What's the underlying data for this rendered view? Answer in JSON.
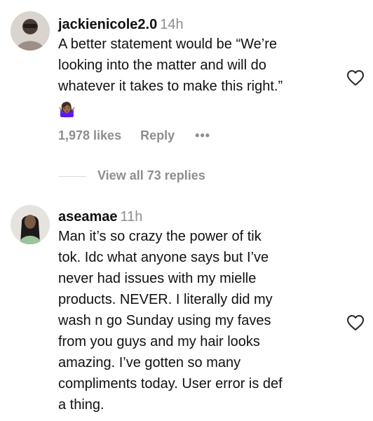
{
  "comments": [
    {
      "username": "jackienicole2.0",
      "time": "14h",
      "text_lines": [
        "A better statement would be “We’re",
        "looking into the matter and will do",
        "whatever it takes to make this right.”"
      ],
      "emoji": "🤷🏾‍♀️",
      "likes": "1,978 likes",
      "reply_label": "Reply",
      "more_label": "•••",
      "view_replies": "View all 73 replies"
    },
    {
      "username": "aseamae",
      "time": "11h",
      "text_lines": [
        "Man it’s so crazy the power of tik",
        "tok. Idc what anyone says but I’ve",
        "never had issues with my mielle",
        "products. NEVER. I literally did my",
        "wash n go Sunday using my faves",
        "from you guys and my hair looks",
        "amazing. I’ve gotten so many",
        "compliments today. User error is def",
        "a thing."
      ]
    }
  ],
  "icons": {
    "like": "heart-outline-icon",
    "avatar": "avatar"
  },
  "colors": {
    "text": "#111111",
    "secondary": "#8e8e8e",
    "divider": "#dbdbdb"
  }
}
